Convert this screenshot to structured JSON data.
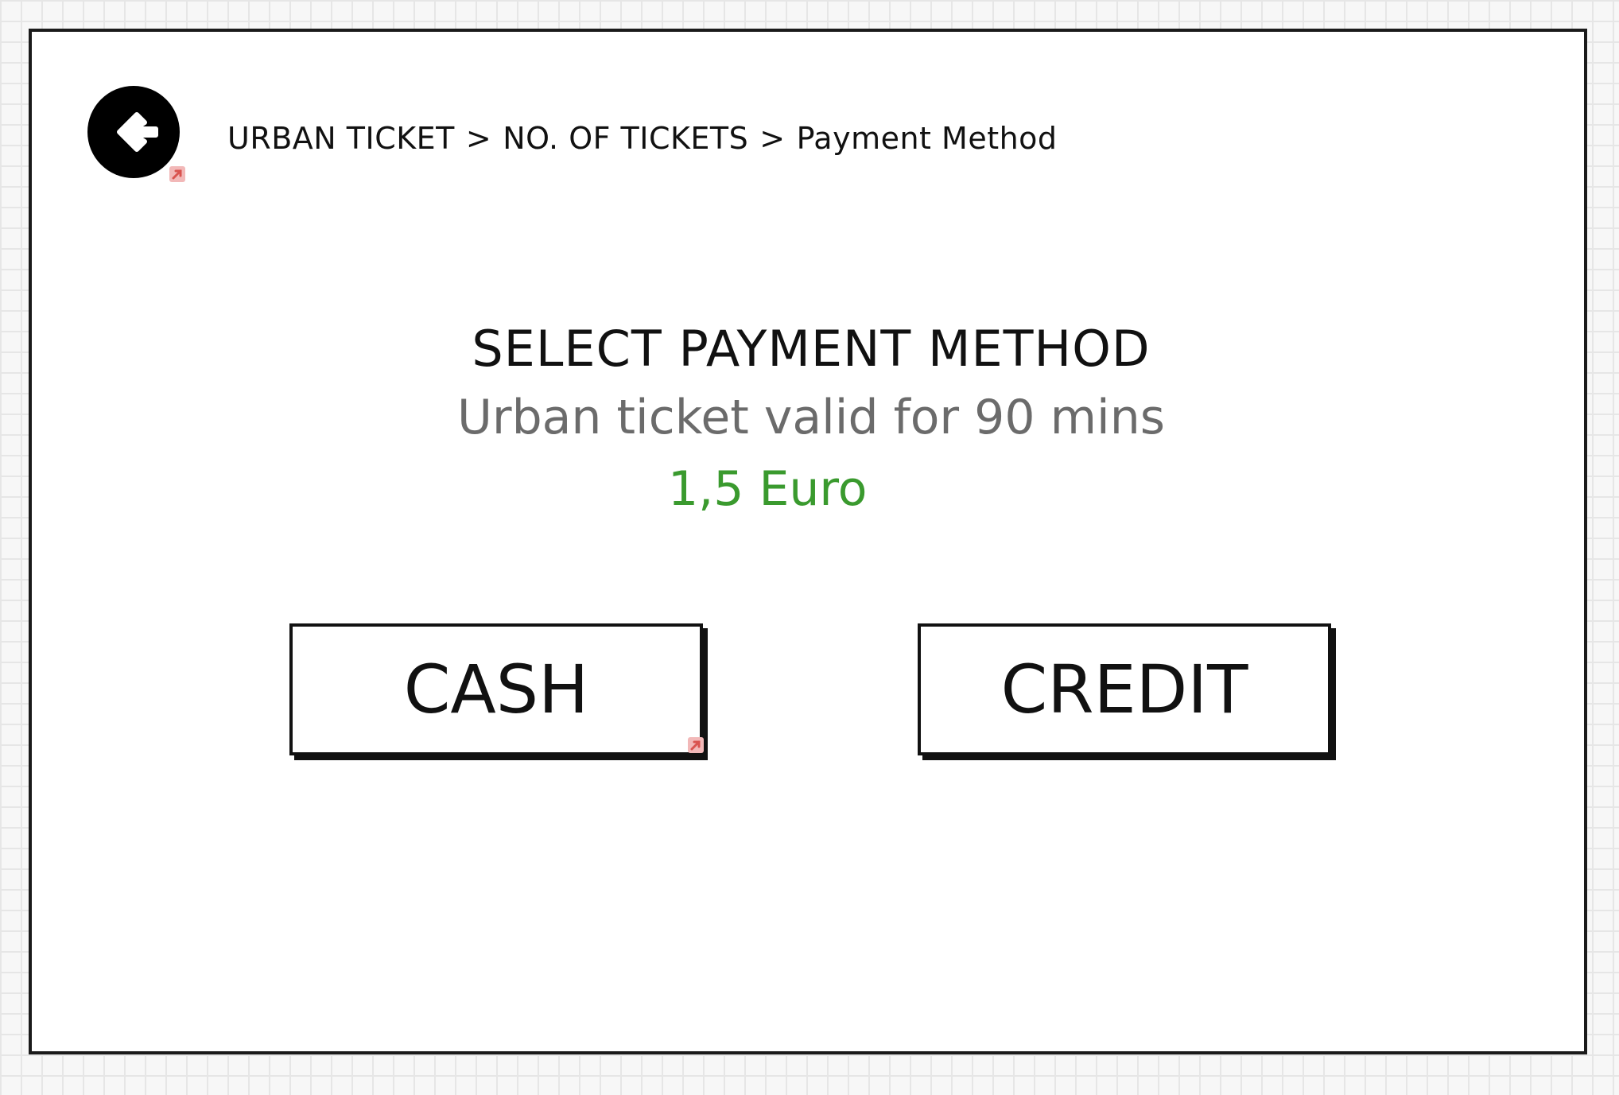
{
  "header": {
    "back_icon": "arrow-left-circle-icon",
    "breadcrumb": {
      "step1": "URBAN TICKET",
      "step2": "NO. OF TICKETS",
      "step3": "Payment Method",
      "separator": ">"
    }
  },
  "main": {
    "title": "SELECT PAYMENT METHOD",
    "subtitle": "Urban ticket valid for 90 mins",
    "price": "1,5 Euro"
  },
  "buttons": {
    "cash_label": "CASH",
    "credit_label": "CREDIT"
  },
  "colors": {
    "price": "#3a9a2e",
    "subtitle": "#6b6b6b",
    "link_marker": "#e06060"
  }
}
